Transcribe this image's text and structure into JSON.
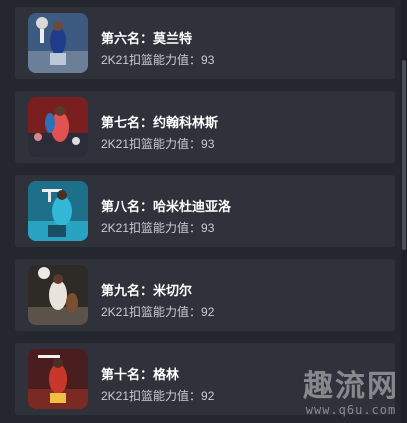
{
  "items": [
    {
      "title": "第六名：莫兰特",
      "stat": "2K21扣篮能力值：93",
      "image": "player-dunk-photo"
    },
    {
      "title": "第七名：约翰科林斯",
      "stat": "2K21扣篮能力值：93",
      "image": "player-dunk-photo"
    },
    {
      "title": "第八名：哈米杜迪亚洛",
      "stat": "2K21扣篮能力值：93",
      "image": "player-dunk-photo"
    },
    {
      "title": "第九名：米切尔",
      "stat": "2K21扣篮能力值：92",
      "image": "player-dunk-photo"
    },
    {
      "title": "第十名：格林",
      "stat": "2K21扣篮能力值：92",
      "image": "player-dunk-photo"
    }
  ],
  "watermark": {
    "logo": "趣流网",
    "url": "www.q6u.com"
  },
  "colors": {
    "background": "#24272e",
    "card": "#2f323a",
    "title": "#ffffff",
    "stat": "#c9ccd3"
  }
}
